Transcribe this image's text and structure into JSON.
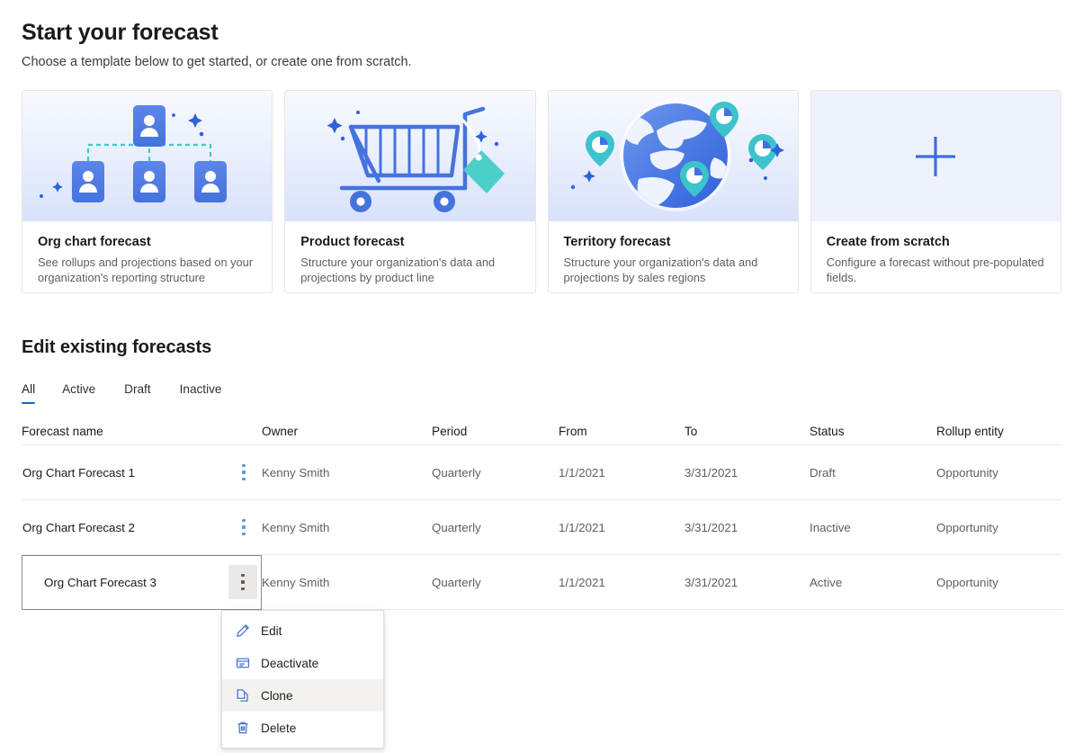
{
  "header": {
    "title": "Start your forecast",
    "subtitle": "Choose a template below to get started, or create one from scratch."
  },
  "templates": [
    {
      "id": "org-chart-forecast",
      "art": "org-chart-illustration",
      "title": "Org chart forecast",
      "description": "See rollups and projections based on your organization's reporting structure"
    },
    {
      "id": "product-forecast",
      "art": "shopping-cart-illustration",
      "title": "Product forecast",
      "description": "Structure your organization's data and projections by product line"
    },
    {
      "id": "territory-forecast",
      "art": "globe-pins-illustration",
      "title": "Territory forecast",
      "description": "Structure your organization's data and projections by sales regions"
    },
    {
      "id": "create-from-scratch",
      "art": "plus-icon",
      "title": "Create from scratch",
      "description": "Configure a forecast without pre-populated fields."
    }
  ],
  "existing": {
    "heading": "Edit existing forecasts",
    "tabs": [
      {
        "label": "All",
        "active": true
      },
      {
        "label": "Active",
        "active": false
      },
      {
        "label": "Draft",
        "active": false
      },
      {
        "label": "Inactive",
        "active": false
      }
    ],
    "columns": [
      "Forecast name",
      "Owner",
      "Period",
      "From",
      "To",
      "Status",
      "Rollup entity"
    ],
    "rows": [
      {
        "name": "Org Chart Forecast 1",
        "owner": "Kenny Smith",
        "period": "Quarterly",
        "from": "1/1/2021",
        "to": "3/31/2021",
        "status": "Draft",
        "rollup": "Opportunity"
      },
      {
        "name": "Org Chart Forecast 2",
        "owner": "Kenny Smith",
        "period": "Quarterly",
        "from": "1/1/2021",
        "to": "3/31/2021",
        "status": "Inactive",
        "rollup": "Opportunity"
      },
      {
        "name": "Org Chart Forecast 3",
        "owner": "Kenny Smith",
        "period": "Quarterly",
        "from": "1/1/2021",
        "to": "3/31/2021",
        "status": "Active",
        "rollup": "Opportunity"
      }
    ]
  },
  "context_menu": {
    "open_for_row": "Org Chart Forecast 3",
    "items": [
      {
        "label": "Edit",
        "icon": "pencil-icon",
        "hover": false
      },
      {
        "label": "Deactivate",
        "icon": "deactivate-icon",
        "hover": false
      },
      {
        "label": "Clone",
        "icon": "copy-icon",
        "hover": true
      },
      {
        "label": "Delete",
        "icon": "trash-icon",
        "hover": false
      }
    ]
  },
  "colors": {
    "accent": "#0f6cbd",
    "illustration_blue": "#4a7ce8",
    "illustration_teal": "#39c2c9",
    "menu_icon_blue": "#3b6fd4",
    "row_border": "#edebe9",
    "text_secondary": "#605e5c"
  }
}
